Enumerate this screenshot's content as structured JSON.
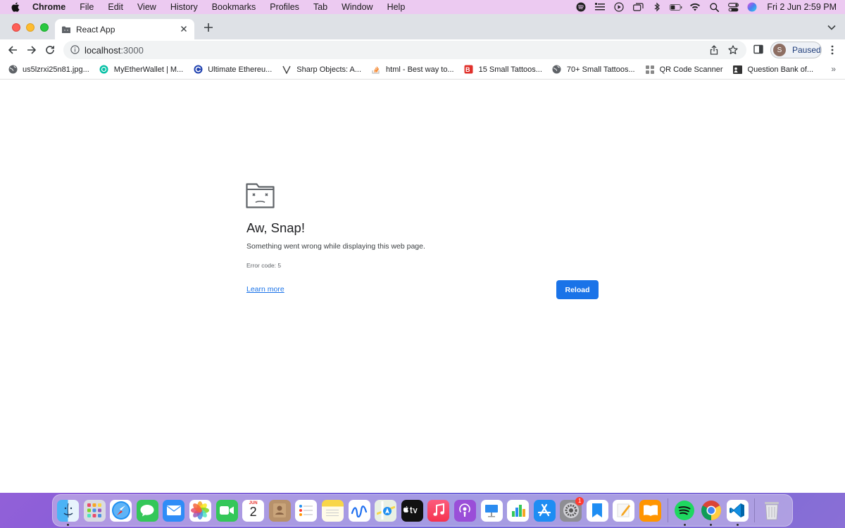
{
  "menubar": {
    "app_name": "Chrome",
    "items": [
      "File",
      "Edit",
      "View",
      "History",
      "Bookmarks",
      "Profiles",
      "Tab",
      "Window",
      "Help"
    ],
    "clock": "Fri 2 Jun  2:59 PM"
  },
  "tab": {
    "title": "React App"
  },
  "omnibox": {
    "host": "localhost",
    "port": ":3000"
  },
  "profile": {
    "initial": "S",
    "status": "Paused"
  },
  "bookmarks": [
    {
      "label": "us5lzrxi25n81.jpg...",
      "icon": "globe-icon"
    },
    {
      "label": "MyEtherWallet | M...",
      "icon": "myetherwallet-icon"
    },
    {
      "label": "Ultimate Ethereu...",
      "icon": "ethereum-icon"
    },
    {
      "label": "Sharp Objects: A...",
      "icon": "v-icon"
    },
    {
      "label": "html - Best way to...",
      "icon": "stackoverflow-icon"
    },
    {
      "label": "15 Small Tattoos...",
      "icon": "tattoo-icon"
    },
    {
      "label": "70+ Small Tattoos...",
      "icon": "globe-icon"
    },
    {
      "label": "QR Code Scanner",
      "icon": "qr-icon"
    },
    {
      "label": "Question Bank of...",
      "icon": "document-icon"
    }
  ],
  "error_page": {
    "title": "Aw, Snap!",
    "message": "Something went wrong while displaying this web page.",
    "error_code": "Error code: 5",
    "learn_more": "Learn more",
    "reload": "Reload"
  },
  "dock": {
    "calendar_month": "JUN",
    "calendar_day": "2",
    "settings_badge": "1",
    "apps": [
      "Finder",
      "Launchpad",
      "Safari",
      "Messages",
      "Mail",
      "Photos",
      "FaceTime",
      "Calendar",
      "Contacts",
      "Reminders",
      "Notes",
      "Freeform",
      "Maps",
      "TV",
      "Music",
      "Podcasts",
      "Keynote",
      "Numbers",
      "App Store",
      "System Settings",
      "Bookmarks",
      "Pages",
      "Books",
      "Spotify",
      "Chrome",
      "VS Code",
      "Trash"
    ]
  },
  "colors": {
    "accent": "#1a73e8",
    "menubar": "#eccaf1"
  }
}
